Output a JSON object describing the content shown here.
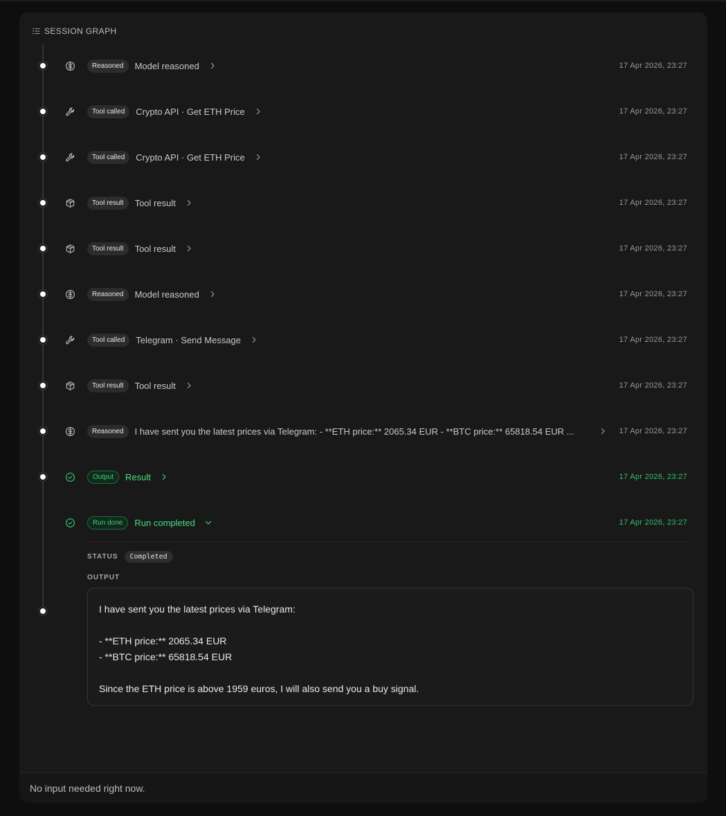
{
  "header": {
    "title": "SESSION GRAPH",
    "icon": "list-icon"
  },
  "events": [
    {
      "icon": "brain-icon",
      "badge": "Reasoned",
      "label": "Model reasoned",
      "time": "17 Apr 2026, 23:27",
      "style": "default"
    },
    {
      "icon": "wrench-icon",
      "badge": "Tool called",
      "label": "Crypto API · Get ETH Price",
      "time": "17 Apr 2026, 23:27",
      "style": "default"
    },
    {
      "icon": "wrench-icon",
      "badge": "Tool called",
      "label": "Crypto API · Get ETH Price",
      "time": "17 Apr 2026, 23:27",
      "style": "default"
    },
    {
      "icon": "box-icon",
      "badge": "Tool result",
      "label": "Tool result",
      "time": "17 Apr 2026, 23:27",
      "style": "default"
    },
    {
      "icon": "box-icon",
      "badge": "Tool result",
      "label": "Tool result",
      "time": "17 Apr 2026, 23:27",
      "style": "default"
    },
    {
      "icon": "brain-icon",
      "badge": "Reasoned",
      "label": "Model reasoned",
      "time": "17 Apr 2026, 23:27",
      "style": "default"
    },
    {
      "icon": "wrench-icon",
      "badge": "Tool called",
      "label": "Telegram · Send Message",
      "time": "17 Apr 2026, 23:27",
      "style": "default"
    },
    {
      "icon": "box-icon",
      "badge": "Tool result",
      "label": "Tool result",
      "time": "17 Apr 2026, 23:27",
      "style": "default"
    },
    {
      "icon": "brain-icon",
      "badge": "Reasoned",
      "label": "I have sent you the latest prices via Telegram: - **ETH price:** 2065.34 EUR - **BTC price:** 65818.54 EUR ...",
      "time": "17 Apr 2026, 23:27",
      "style": "default"
    },
    {
      "icon": "check-circle-icon",
      "badge": "Output",
      "label": "Result",
      "time": "17 Apr 2026, 23:27",
      "style": "green"
    },
    {
      "icon": "check-circle-icon",
      "badge": "Run done",
      "label": "Run completed",
      "time": "17 Apr 2026, 23:27",
      "style": "green",
      "expanded": true
    }
  ],
  "details": {
    "status_label": "STATUS",
    "status_value": "Completed",
    "output_label": "OUTPUT",
    "output_lines": [
      "I have sent you the latest prices via Telegram:",
      "",
      "- **ETH price:** 2065.34 EUR",
      "- **BTC price:** 65818.54 EUR",
      "",
      "Since the ETH price is above 1959 euros, I will also send you a buy signal."
    ]
  },
  "footer": {
    "text": "No input needed right now."
  },
  "colors": {
    "accent_green": "#4ade80",
    "background": "#191919",
    "badge": "#2c2c2c"
  }
}
